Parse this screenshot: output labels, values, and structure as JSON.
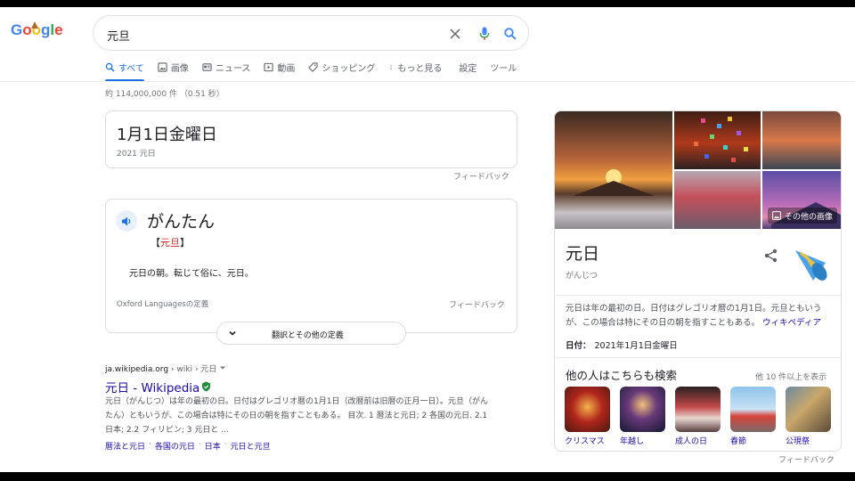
{
  "search": {
    "query": "元旦"
  },
  "tabs": [
    {
      "label": "すべて",
      "icon": "search-icon",
      "active": true
    },
    {
      "label": "画像",
      "icon": "image-icon"
    },
    {
      "label": "ニュース",
      "icon": "news-icon"
    },
    {
      "label": "動画",
      "icon": "video-icon"
    },
    {
      "label": "ショッピング",
      "icon": "tag-icon"
    },
    {
      "label": "もっと見る",
      "icon": "more-vert-icon"
    },
    {
      "label": "設定"
    },
    {
      "label": "ツール"
    }
  ],
  "stats": "約 114,000,000 件 （0.51 秒）",
  "date_card": {
    "main": "1月1日金曜日",
    "sub": "2021 元日",
    "feedback": "フィードバック"
  },
  "dictionary": {
    "word": "がんたん",
    "kanji_open": "【",
    "kanji": "元旦",
    "kanji_close": "】",
    "definition": "元日の朝。転じて俗に、元日。",
    "source": "Oxford Languagesの定義",
    "feedback": "フィードバック",
    "more_button": "翻訳とその他の定義"
  },
  "result": {
    "domain": "ja.wikipedia.org",
    "breadcrumb": " › wiki › 元日",
    "title": "元日 - Wikipedia",
    "snippet": "元日（がんじつ）は年の最初の日。日付はグレゴリオ暦の1月1日（改暦前は旧暦の正月一日）。元旦（がんたん）ともいうが、この場合は特にその日の朝を指すこともある。 目次. 1 暦法と元日; 2 各国の元日. 2.1 日本; 2.2 フィリピン; 3 元日と ...",
    "sitelinks": [
      "暦法と元日",
      "各国の元日",
      "日本",
      "元日と元旦"
    ]
  },
  "knowledge_panel": {
    "more_images": "その他の画像",
    "title": "元日",
    "subtitle": "がんじつ",
    "description": "元日は年の最初の日。日付はグレゴリオ暦の1月1日。元旦ともいうが、この場合は特にその日の朝を指すこともある。",
    "description_source": "ウィキペディア",
    "date_label": "日付：",
    "date_value": "2021年1月1日金曜日",
    "related_title": "他の人はこちらも検索",
    "related_more": "他 10 件以上を表示",
    "related": [
      {
        "label": "クリスマス"
      },
      {
        "label": "年越し"
      },
      {
        "label": "成人の日"
      },
      {
        "label": "春節"
      },
      {
        "label": "公現祭"
      }
    ],
    "feedback": "フィードバック"
  },
  "colors": {
    "link": "#1a0dab",
    "accent": "#1a73e8",
    "muted": "#70757a"
  }
}
